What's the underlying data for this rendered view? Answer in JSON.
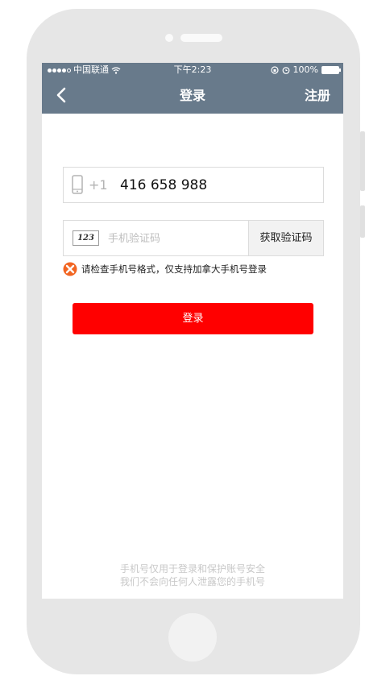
{
  "status_bar": {
    "carrier": "中国联通",
    "time": "下午2:23",
    "battery": "100%"
  },
  "nav": {
    "title": "登录",
    "right_label": "注册"
  },
  "phone_field": {
    "country_code": "+1",
    "value": "416 658 988"
  },
  "code_field": {
    "icon_text": "123",
    "placeholder": "手机验证码",
    "button_label": "获取验证码"
  },
  "error": {
    "message": "请检查手机号格式，仅支持加拿大手机号登录"
  },
  "login_button": {
    "label": "登录"
  },
  "footer": {
    "line1": "手机号仅用于登录和保护账号安全",
    "line2": "我们不会向任何人泄露您的手机号"
  },
  "colors": {
    "header": "#687a8b",
    "primary_button": "#ff0000",
    "error_icon": "#f26522"
  }
}
